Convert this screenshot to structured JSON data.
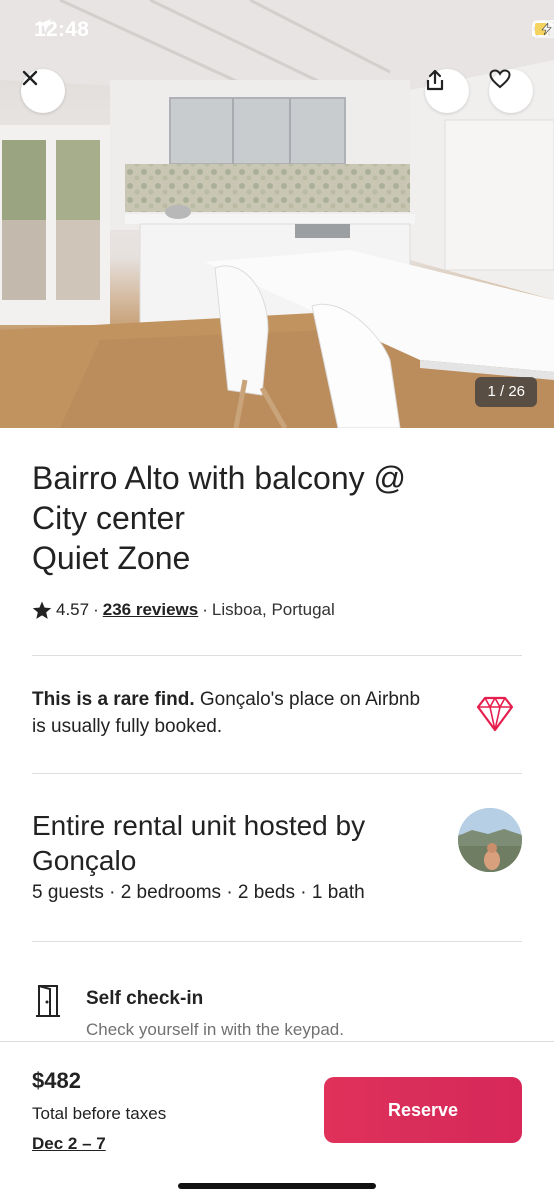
{
  "status_bar": {
    "time": "12:48"
  },
  "hero": {
    "photo_counter": "1 / 26"
  },
  "listing": {
    "title_line1": "Bairro Alto with balcony @",
    "title_line2": "City center",
    "title_line3": "Quiet Zone",
    "rating": "4.57",
    "reviews": "236 reviews",
    "location": "Lisboa, Portugal",
    "separator": "·"
  },
  "rare_find": {
    "bold": "This is a rare find.",
    "text": " Gonçalo's place on Airbnb is usually fully booked."
  },
  "host": {
    "title": "Entire rental unit hosted by Gonçalo",
    "details": "5 guests · 2 bedrooms · 2 beds · 1 bath"
  },
  "feature": {
    "title": "Self check-in",
    "subtitle": "Check yourself in with the keypad."
  },
  "footer": {
    "price": "$482",
    "price_note": "Total before taxes",
    "dates": "Dec 2 – 7",
    "reserve_label": "Reserve"
  },
  "colors": {
    "brand": "#E0315A",
    "gem": "#E61E4D"
  }
}
